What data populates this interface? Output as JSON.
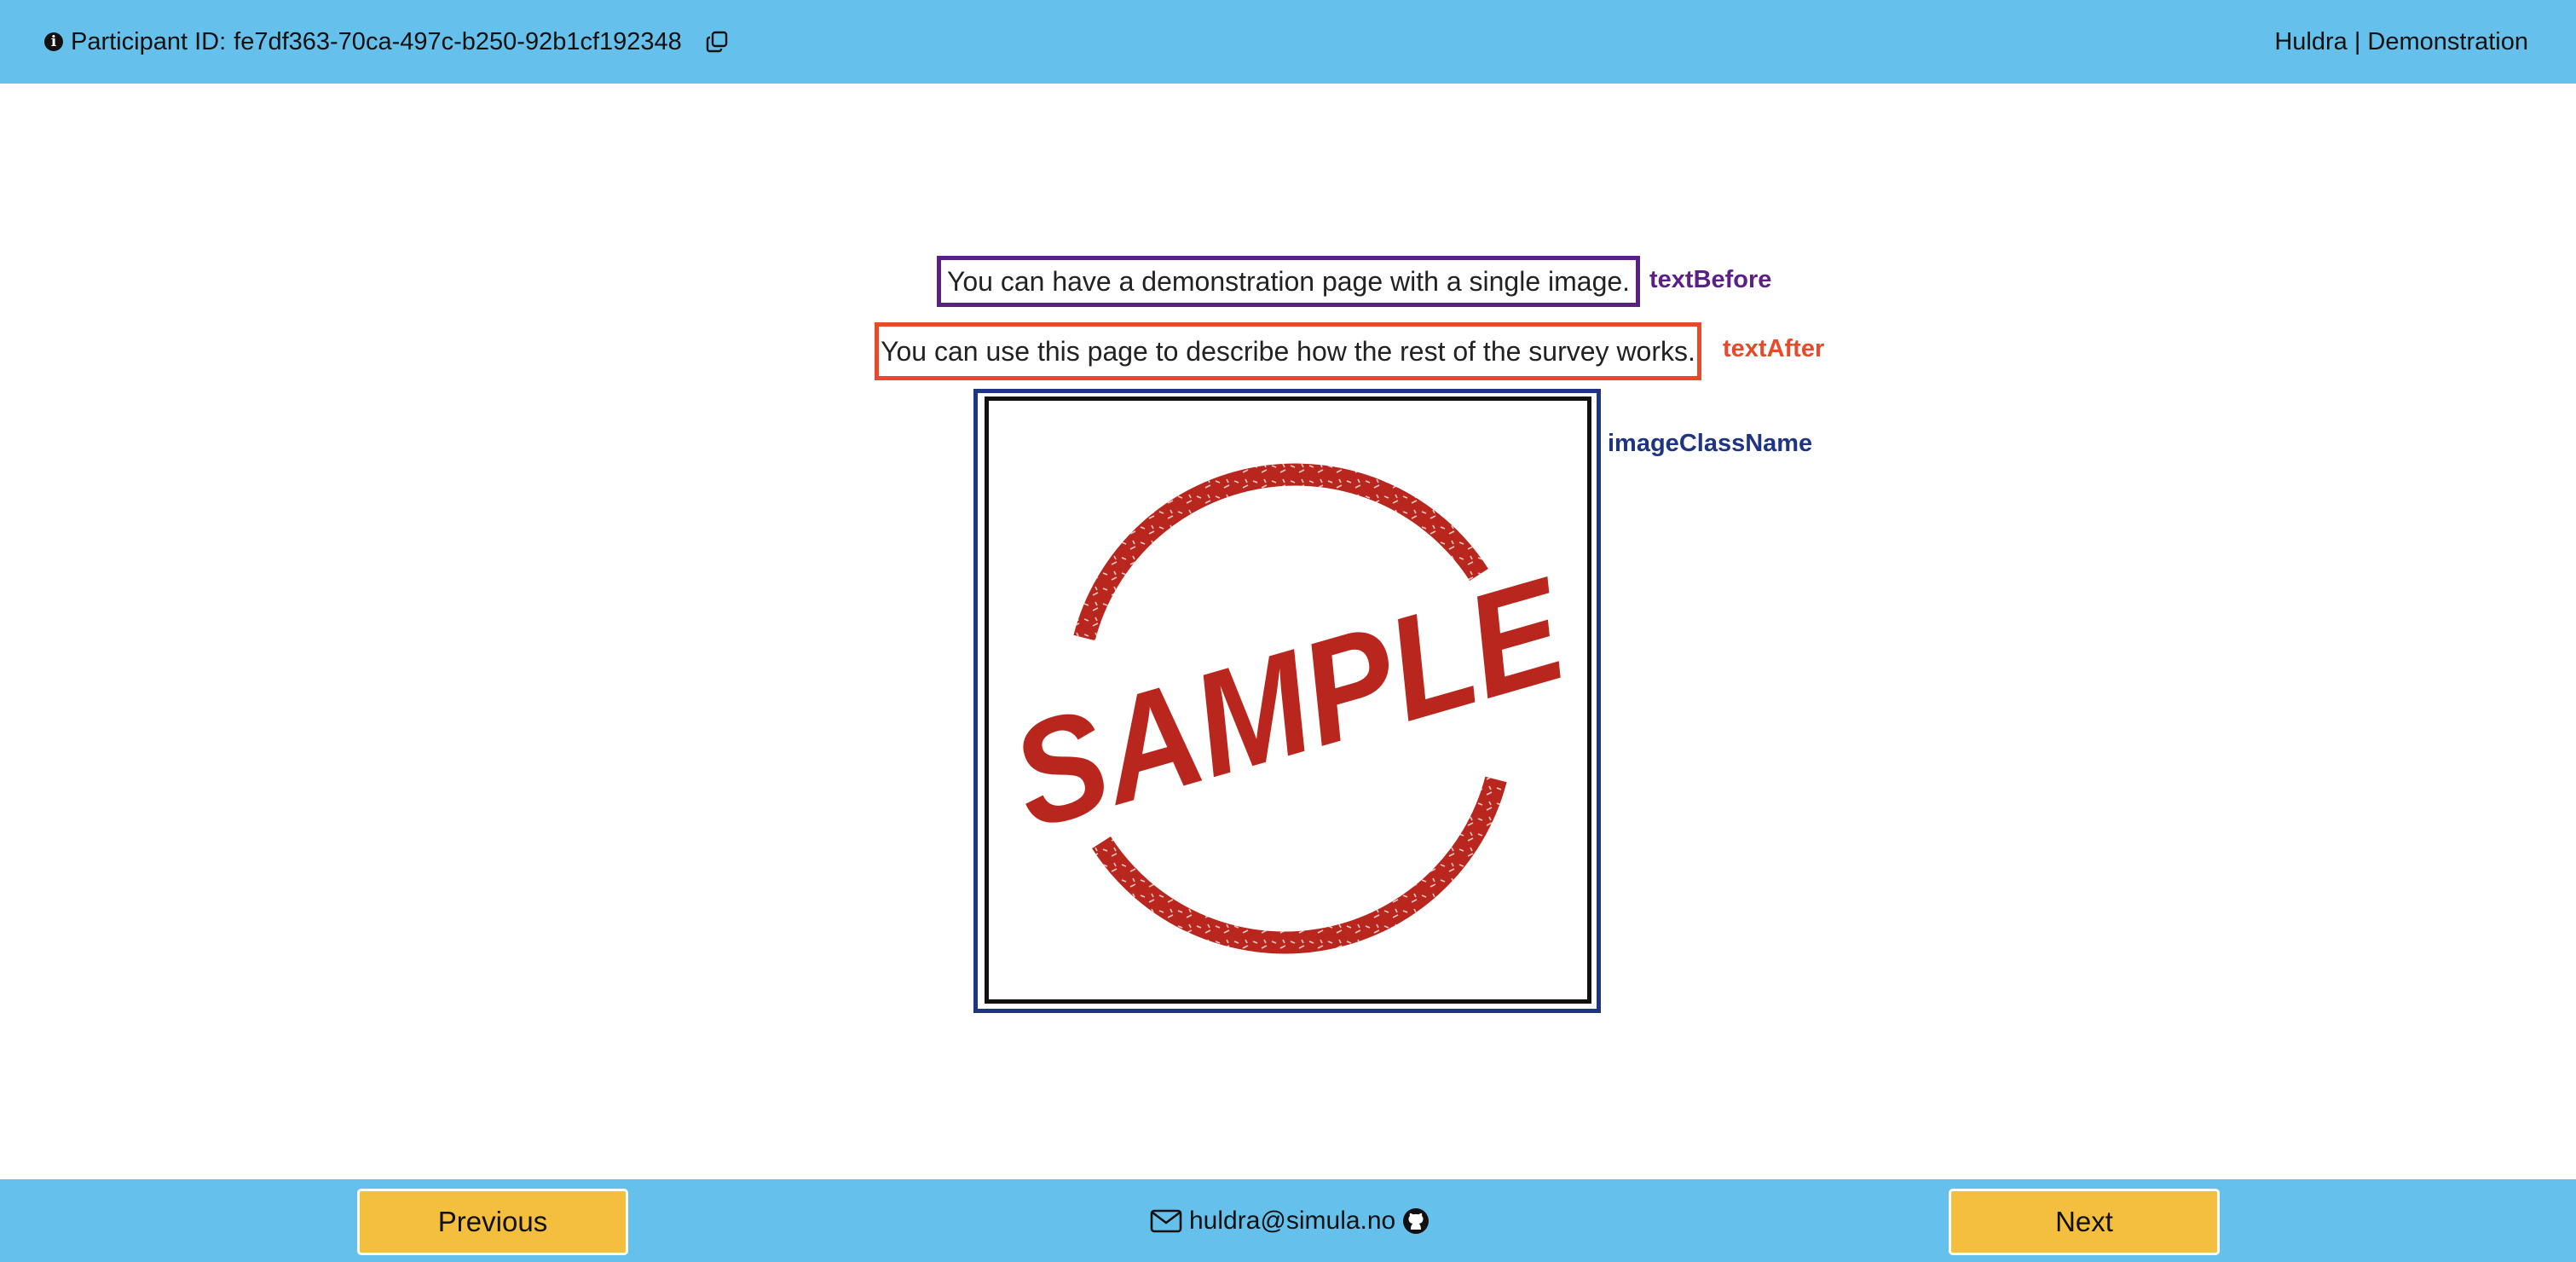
{
  "header": {
    "participant_label": "Participant ID:",
    "participant_id": "fe7df363-70ca-497c-b250-92b1cf192348",
    "brand": "Huldra | Demonstration",
    "icons": [
      "info-icon",
      "copy-icon"
    ]
  },
  "content": {
    "text_before": "You can have a demonstration page with a single image.",
    "text_after": "You can use this page to describe how the rest of the survey works.",
    "annotations": {
      "text_before": "textBefore",
      "text_after": "textAfter",
      "image_class_name": "imageClassName"
    },
    "image": {
      "stamp_text": "SAMPLE",
      "stamp_color": "#b9261d"
    },
    "colors": {
      "text_before_border": "#5b1f86",
      "text_after_border": "#e8492b",
      "image_border": "#1f3584"
    }
  },
  "footer": {
    "previous_label": "Previous",
    "next_label": "Next",
    "email": "huldra@simula.no",
    "icons": [
      "mail-icon",
      "github-icon"
    ],
    "button_color": "#f4bf3f",
    "bar_color": "#66c0ec"
  }
}
